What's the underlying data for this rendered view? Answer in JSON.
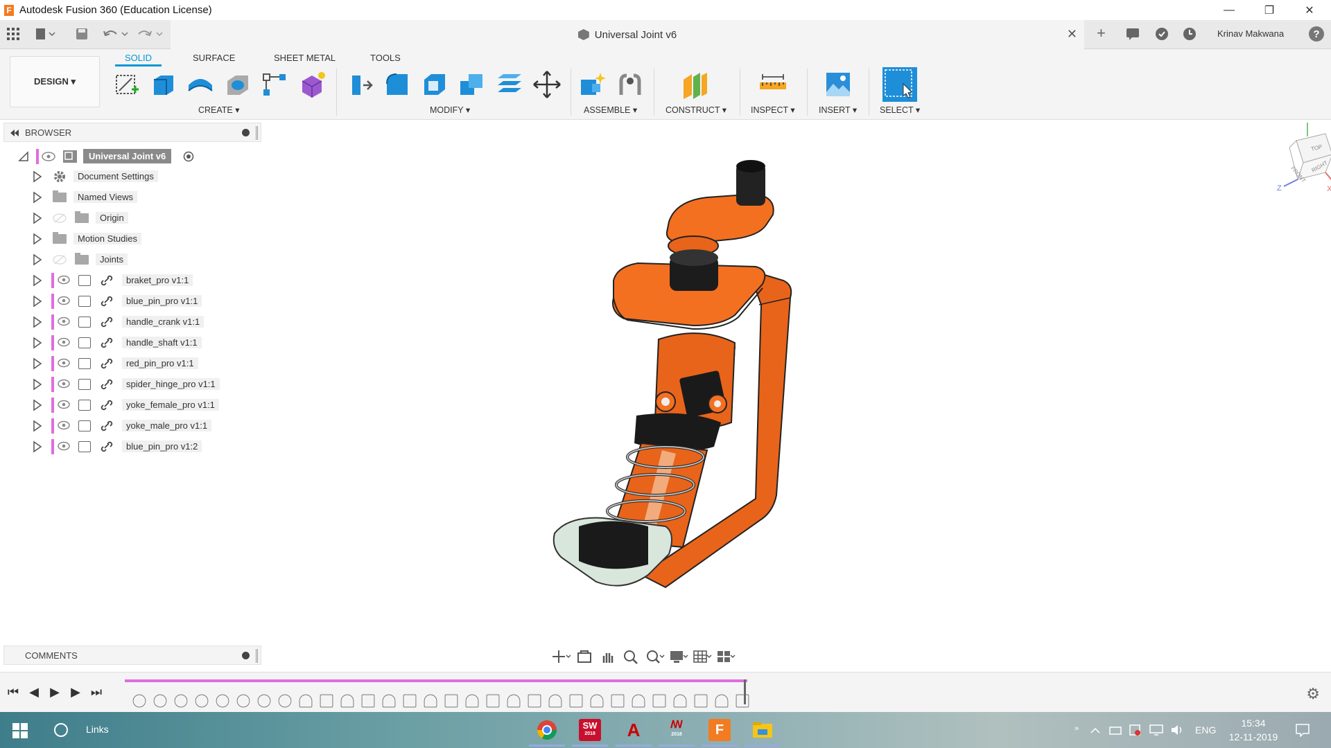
{
  "window": {
    "title": "Autodesk Fusion 360 (Education License)",
    "app_icon_letter": "F",
    "minimize": "—",
    "restore": "❐",
    "close": "✕"
  },
  "qat": {
    "document_name": "Universal Joint v6",
    "close_tab": "✕",
    "user_name": "Krinav Makwana",
    "help": "?"
  },
  "ribbon": {
    "workspace": "DESIGN ▾",
    "tabs": [
      "SOLID",
      "SURFACE",
      "SHEET METAL",
      "TOOLS"
    ],
    "active_tab": "SOLID",
    "groups": [
      "CREATE ▾",
      "MODIFY ▾",
      "ASSEMBLE ▾",
      "CONSTRUCT ▾",
      "INSPECT ▾",
      "INSERT ▾",
      "SELECT ▾"
    ]
  },
  "browser": {
    "header": "BROWSER",
    "root": "Universal Joint v6",
    "items": [
      {
        "label": "Document Settings",
        "kind": "settings"
      },
      {
        "label": "Named Views",
        "kind": "folder"
      },
      {
        "label": "Origin",
        "kind": "folder-hidden"
      },
      {
        "label": "Motion Studies",
        "kind": "folder"
      },
      {
        "label": "Joints",
        "kind": "folder-hidden"
      },
      {
        "label": "braket_pro v1:1",
        "kind": "component"
      },
      {
        "label": "blue_pin_pro v1:1",
        "kind": "component"
      },
      {
        "label": "handle_crank v1:1",
        "kind": "component"
      },
      {
        "label": "handle_shaft v1:1",
        "kind": "component"
      },
      {
        "label": "red_pin_pro v1:1",
        "kind": "component"
      },
      {
        "label": "spider_hinge_pro v1:1",
        "kind": "component"
      },
      {
        "label": "yoke_female_pro v1:1",
        "kind": "component"
      },
      {
        "label": "yoke_male_pro v1:1",
        "kind": "component"
      },
      {
        "label": "blue_pin_pro v1:2",
        "kind": "component"
      }
    ]
  },
  "comments": {
    "header": "COMMENTS"
  },
  "viewcube": {
    "top": "TOP",
    "front": "FRONT",
    "right": "RIGHT",
    "axis_x": "X",
    "axis_z": "Z"
  },
  "timeline": {
    "play": "▶",
    "prev": "◀",
    "next": "▶",
    "first": "⏮",
    "last": "⏭",
    "settings": "⚙"
  },
  "taskbar": {
    "search_label": "Links",
    "language": "ENG",
    "time": "15:34",
    "date": "12-11-2019",
    "apps": [
      "chrome",
      "solidworks",
      "acrobat",
      "msc",
      "fusion",
      "explorer"
    ],
    "solidworks_year": "2018",
    "msc_year": "2018"
  },
  "colors": {
    "accent": "#0696d7",
    "model_orange": "#f37021",
    "timeline_bar": "#e06ce0"
  }
}
